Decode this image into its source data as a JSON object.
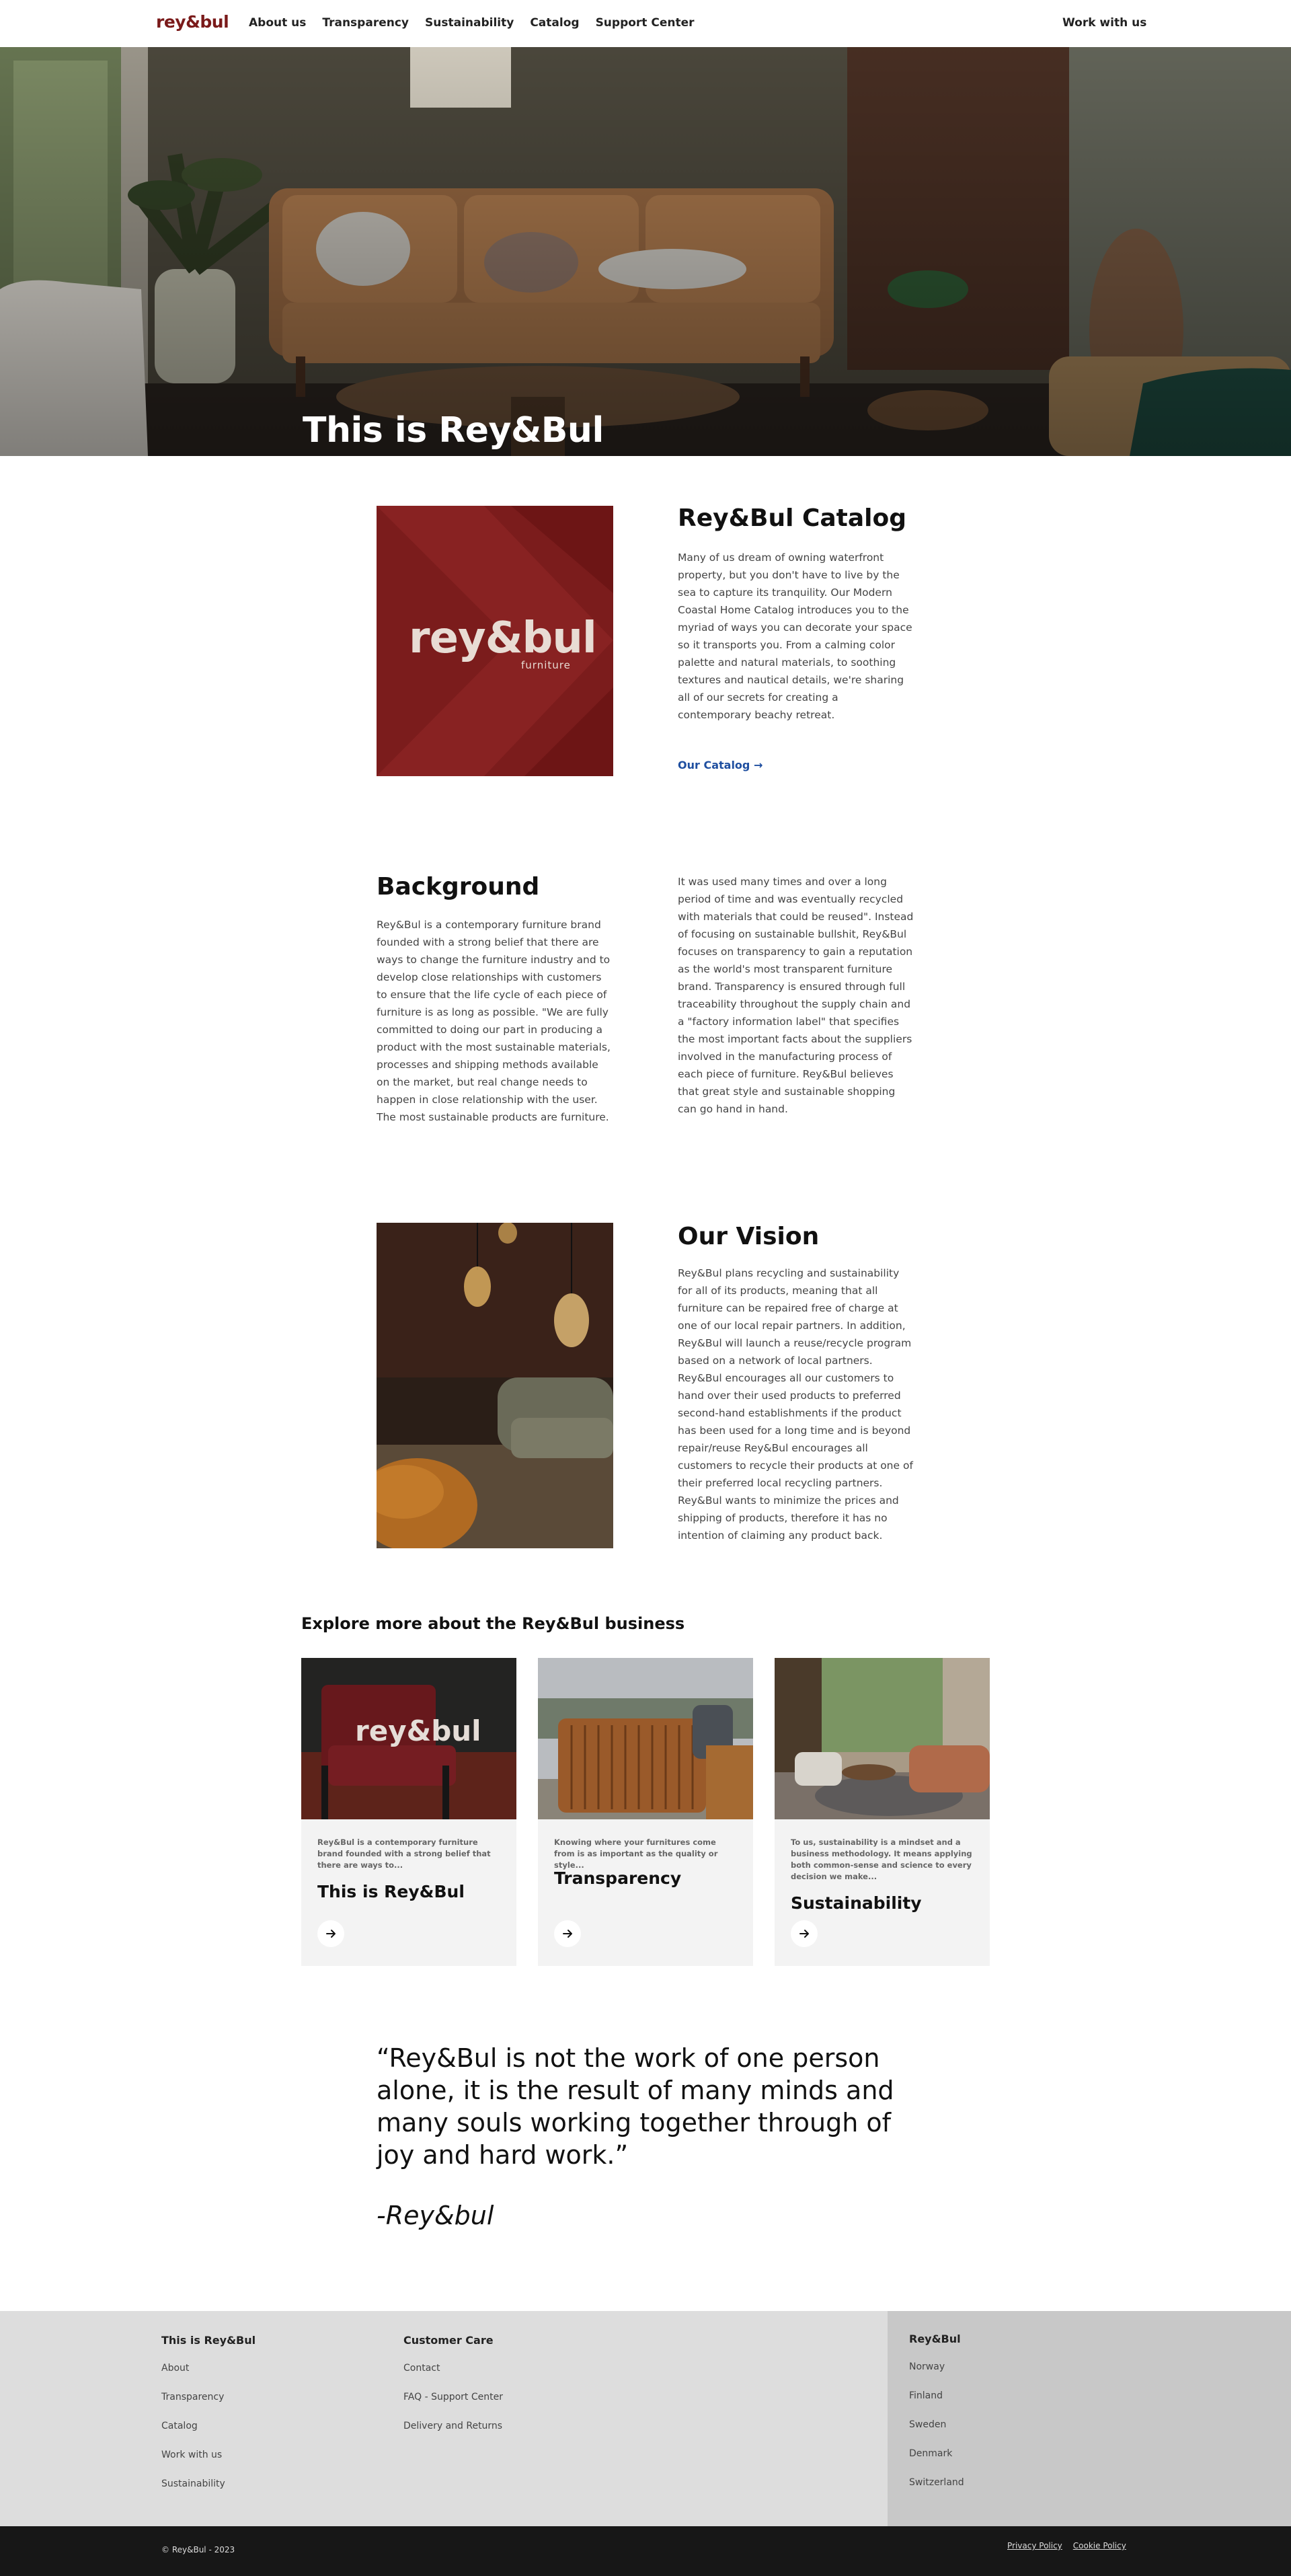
{
  "brand": {
    "logo": "rey&bul",
    "accent": "#7a1a1a",
    "link_color": "#1f4fa0"
  },
  "nav": {
    "links": [
      "About us",
      "Transparency",
      "Sustainability",
      "Catalog",
      "Support Center"
    ],
    "cta": "Work with us"
  },
  "hero": {
    "title": "This is Rey&Bul"
  },
  "catalog": {
    "title": "Rey&Bul Catalog",
    "body": "Many of us dream of owning waterfront property, but you don't have to live by the sea to capture its tranquility. Our Modern Coastal Home Catalog introduces you to the myriad of ways you can decorate your space so it transports you. From a calming color palette and natural materials, to soothing textures and nautical details, we're sharing all of our secrets for creating a contemporary beachy retreat.",
    "link": "Our Catalog →",
    "image_logo": "rey&bul",
    "image_sub": "furniture"
  },
  "background": {
    "title": "Background",
    "body_left": "Rey&Bul is a contemporary furniture brand founded with a strong belief that there are ways to change the furniture industry and to develop close relationships with customers to ensure that the life cycle of each piece of furniture is as long as possible. \"We are fully committed to doing our part in producing a product with the most sustainable materials, processes and shipping methods available on the market, but real change needs to happen in close relationship with the user. The most sustainable products are furniture.",
    "body_right": "It was used many times and over a long period of time and was eventually recycled with materials that could be reused\". Instead of focusing on sustainable bullshit, Rey&Bul focuses on transparency to gain a reputation as the world's most transparent furniture brand. Transparency is ensured through full traceability throughout the supply chain and a \"factory information label\" that specifies the most important facts about the suppliers involved in the manufacturing process of each piece of furniture. Rey&Bul believes that great style and sustainable shopping can go hand in hand."
  },
  "vision": {
    "title": "Our Vision",
    "body": "Rey&Bul plans recycling and sustainability for all of its products, meaning that all furniture can be repaired free of charge at one of our local repair partners. In addition, Rey&Bul will launch a reuse/recycle program based on a network of local partners. Rey&Bul encourages all our customers to hand over their used products to preferred second-hand establishments if the product has been used for a long time and is beyond repair/reuse Rey&Bul encourages all customers to recycle their products at one of their preferred local recycling partners. Rey&Bul wants to minimize the prices and shipping of products, therefore it has no intention of claiming any product back."
  },
  "explore": {
    "title": "Explore more about the Rey&Bul business",
    "cards": [
      {
        "desc": "Rey&Bul is a contemporary furniture brand founded with a strong belief that there are ways to...",
        "title": "This is Rey&Bul",
        "image_logo": "rey&bul",
        "button_icon": "arrow-right-icon"
      },
      {
        "desc": "Knowing where your furnitures come from is as important as the quality or style...",
        "title": "Transparency",
        "button_icon": "arrow-right-icon"
      },
      {
        "desc": "To us, sustainability is a mindset and a business methodology. It means applying both common-sense and science to every decision we make...",
        "title": "Sustainability",
        "button_icon": "arrow-right-icon"
      }
    ]
  },
  "quote": {
    "text": "“Rey&Bul is not the work of one person alone, it is the result of many minds and many souls working together through of joy and hard work.”",
    "author": "-Rey&bul"
  },
  "footer": {
    "col1": {
      "heading": "This is Rey&Bul",
      "items": [
        "About",
        "Transparency",
        "Catalog",
        "Work with us",
        "Sustainability"
      ]
    },
    "col2": {
      "heading": "Customer Care",
      "items": [
        "Contact",
        "FAQ - Support Center",
        "Delivery and Returns"
      ]
    },
    "col3": {
      "heading": "Rey&Bul",
      "items": [
        "Norway",
        "Finland",
        "Sweden",
        "Denmark",
        "Switzerland"
      ]
    },
    "copyright": "© Rey&Bul - 2023",
    "legal": [
      "Privacy Policy",
      "Cookie Policy"
    ]
  }
}
